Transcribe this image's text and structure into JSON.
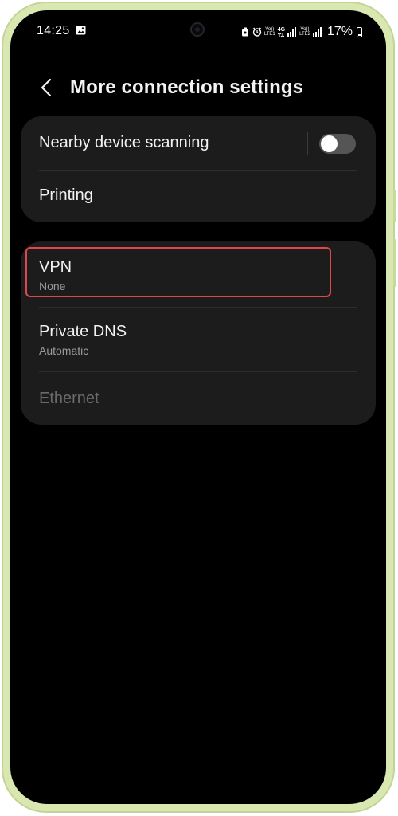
{
  "status_bar": {
    "time": "14:25",
    "gallery_icon": "image-icon",
    "notification_icons": [
      "alarm-clock-icon",
      "alarm-icon"
    ],
    "sim1_label_top": "Vo))",
    "sim1_label_bottom": "LTE1",
    "network_type": "4G",
    "sim2_label_top": "Vo))",
    "sim2_label_bottom": "LTE2",
    "battery_percent": "17%"
  },
  "header": {
    "back_icon": "chevron-left-icon",
    "title": "More connection settings"
  },
  "group1": {
    "items": [
      {
        "title": "Nearby device scanning",
        "toggle_on": false
      },
      {
        "title": "Printing"
      }
    ]
  },
  "group2": {
    "items": [
      {
        "title": "VPN",
        "subtitle": "None",
        "highlighted": true
      },
      {
        "title": "Private DNS",
        "subtitle": "Automatic"
      },
      {
        "title": "Ethernet",
        "disabled": true
      }
    ]
  },
  "colors": {
    "frame": "#d9e8b0",
    "screen_bg": "#000000",
    "card_bg": "#1c1c1c",
    "highlight": "#e0474c",
    "toggle_off": "#555555",
    "text_primary": "#f2f2f2",
    "text_secondary": "#9a9a9a",
    "text_disabled": "#6a6a6a"
  }
}
